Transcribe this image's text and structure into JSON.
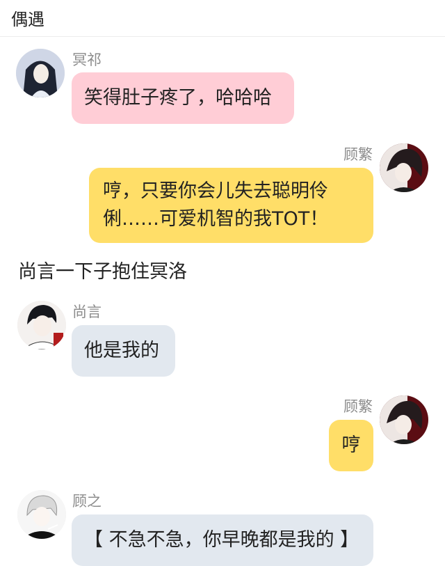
{
  "header": {
    "title": "偶遇"
  },
  "messages": [
    {
      "name": "冥祁",
      "text": "笑得肚子疼了，哈哈哈",
      "side": "left",
      "bubble_color": "#ffcdd6",
      "avatar": "avatar-long-hair-icon"
    },
    {
      "name": "顾繁",
      "text": "哼，只要你会儿失去聪明伶俐……可爱机智的我TOT！",
      "side": "right",
      "bubble_color": "#ffde68",
      "avatar": "avatar-dark-hair-red-icon"
    },
    {
      "name": "尚言",
      "text": "他是我的",
      "side": "left",
      "bubble_color": "#e2e8ef",
      "avatar": "avatar-black-hair-icon"
    },
    {
      "name": "顾繁",
      "text": "哼",
      "side": "right",
      "bubble_color": "#ffde68",
      "avatar": "avatar-dark-hair-red-icon"
    },
    {
      "name": "顾之",
      "text": "【 不急不急，你早晚都是我的 】",
      "side": "left",
      "bubble_color": "#e2e8ef",
      "avatar": "avatar-white-hair-icon"
    }
  ],
  "narration": "尚言一下子抱住冥洛"
}
